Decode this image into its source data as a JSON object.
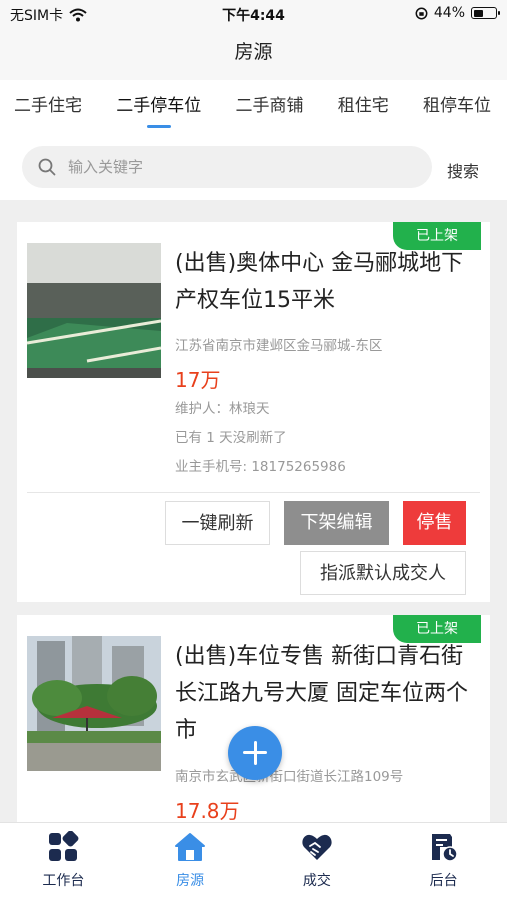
{
  "status_bar": {
    "carrier": "无SIM卡",
    "time": "下午4:44",
    "battery_percent": "44%",
    "battery_level": 0.44
  },
  "nav": {
    "title": "房源"
  },
  "tabs": [
    {
      "label": "二手住宅",
      "active": false
    },
    {
      "label": "二手停车位",
      "active": true
    },
    {
      "label": "二手商铺",
      "active": false
    },
    {
      "label": "租住宅",
      "active": false
    },
    {
      "label": "租停车位",
      "active": false
    }
  ],
  "search": {
    "placeholder": "输入关键字",
    "button_label": "搜索"
  },
  "listings": [
    {
      "badge": "已上架",
      "title": "(出售)奥体中心 金马郦城地下产权车位15平米",
      "address": "江苏省南京市建邺区金马郦城-东区",
      "price": "17万",
      "maintainer": "维护人：林琅天",
      "refresh_note": "已有 1 天没刷新了",
      "owner_phone": "业主手机号: 18175265986",
      "actions": {
        "refresh": "一键刷新",
        "unlist_edit": "下架编辑",
        "stop_sale": "停售",
        "assign": "指派默认成交人"
      }
    },
    {
      "badge": "已上架",
      "title": "(出售)车位专售 新街口青石街 长江路九号大厦 固定车位两个市",
      "address": "南京市玄武区新街口街道长江路109号",
      "price": "17.8万"
    }
  ],
  "bottom_tabs": [
    {
      "label": "工作台",
      "icon": "workbench-icon",
      "active": false
    },
    {
      "label": "房源",
      "icon": "house-icon",
      "active": true
    },
    {
      "label": "成交",
      "icon": "handshake-heart-icon",
      "active": false
    },
    {
      "label": "后台",
      "icon": "admin-icon",
      "active": false
    }
  ],
  "colors": {
    "accent": "#3a8ee6",
    "badge": "#22b14c",
    "price": "#e8401c",
    "stop_button": "#ee3b3b",
    "edit_button": "#8e8e8e",
    "tab_icon": "#1c2b4f"
  }
}
